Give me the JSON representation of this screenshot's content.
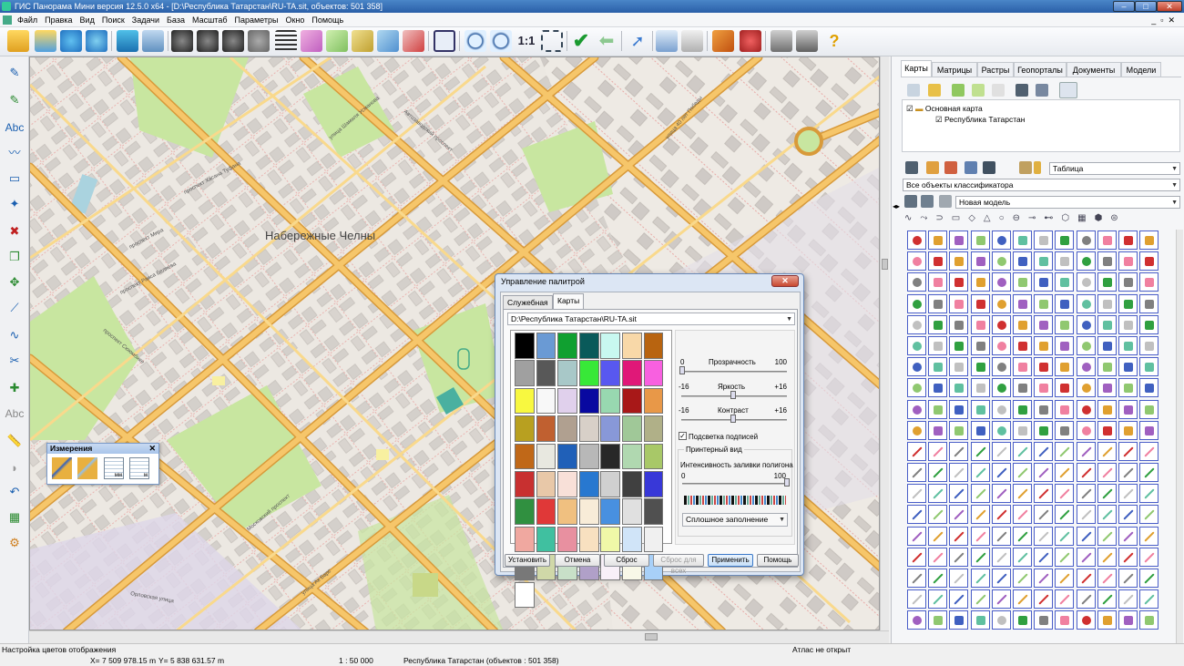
{
  "window": {
    "title": "ГИС Панорама Мини версия 12.5.0 x64 - [D:\\Республика Татарстан\\RU-TA.sit, объектов: 501 358]"
  },
  "menu": [
    "Файл",
    "Правка",
    "Вид",
    "Поиск",
    "Задачи",
    "База",
    "Масштаб",
    "Параметры",
    "Окно",
    "Помощь"
  ],
  "map": {
    "city_label": "Набережные Челны",
    "street_labels": [
      "проспект Хасана Туфана",
      "проспект Мира",
      "улица Шамиля Усманова",
      "проспект Сююмбике",
      "Московский проспект",
      "проспект Раиса Беляева",
      "улица 40 лет Победы",
      "Орловская улица",
      "Автозаводский проспект",
      "улица Ак Барс"
    ]
  },
  "measure_panel": {
    "title": "Измерения",
    "units": [
      "мм",
      "м"
    ]
  },
  "dialog": {
    "title": "Управление палитрой",
    "tabs": [
      "Служебная",
      "Карты"
    ],
    "file_path": "D:\\Республика Татарстан\\RU-TA.sit",
    "palette_colors": [
      "#000000",
      "#6a9ad4",
      "#10a030",
      "#0a5a5a",
      "#c8f8f0",
      "#f8d8a8",
      "#b86410",
      "#a0a0a0",
      "#585858",
      "#a8c8c8",
      "#38e838",
      "#5858f0",
      "#e01878",
      "#f860e0",
      "#f8f840",
      "#f8f8f8",
      "#e0d0ec",
      "#0808a0",
      "#98d8b0",
      "#a81818",
      "#e89848",
      "#b8a020",
      "#c06030",
      "#b0a090",
      "#d8d0c8",
      "#8898d8",
      "#a0c898",
      "#b0b088",
      "#c06818",
      "#e8e8e0",
      "#2060b8",
      "#b8b8b8",
      "#282828",
      "#b0d8b0",
      "#a8c868",
      "#c83030",
      "#e8c8a8",
      "#f8e0d8",
      "#2878d0",
      "#d0d0d0",
      "#404040",
      "#3838d8",
      "#309040",
      "#e03838",
      "#f0c080",
      "#f8ecd8",
      "#4890e0",
      "#e0e0e0",
      "#505050",
      "#f0a8a0",
      "#40c0a0",
      "#e890a0",
      "#f8e0c0",
      "#f0f8a8",
      "#d0e4f8",
      "#f0f0f0",
      "#787878",
      "#d0d8a8",
      "#c8e0c8",
      "#b0a0c8",
      "#f8f0f8",
      "#f8f8e8",
      "#a8d0f8",
      "#ffffff"
    ],
    "transparency": {
      "label": "Прозрачность",
      "min": "0",
      "max": "100",
      "value": 0
    },
    "brightness": {
      "label": "Яркость",
      "min": "-16",
      "max": "+16",
      "value": 0.5
    },
    "contrast": {
      "label": "Контраст",
      "min": "-16",
      "max": "+16",
      "value": 0.5
    },
    "highlight_labels": {
      "label": "Подсветка подписей",
      "checked": true
    },
    "printer_group": "Принтерный вид",
    "fill_intensity": {
      "label": "Интенсивность заливки полигона",
      "min": "0",
      "max": "100",
      "value": 1.0
    },
    "fill_mode": "Сплошное заполнение",
    "buttons": {
      "set": "Установить",
      "cancel": "Отмена",
      "reset": "Сброс",
      "reset_all": "Сброс для всех",
      "apply": "Применить",
      "help": "Помощь"
    }
  },
  "right_panel": {
    "tabs": [
      "Карты",
      "Матрицы",
      "Растры",
      "Геопорталы",
      "Документы",
      "Модели"
    ],
    "active_tab": "Карты",
    "tree": {
      "root": "Основная карта",
      "child": "Республика Татарстан"
    },
    "view_select": "Таблица",
    "classifier_select": "Все объекты классификатора",
    "model_select": "Новая модель"
  },
  "status": {
    "message": "Настройка цветов отображения",
    "atlas": "Атлас не открыт",
    "x": "X= 7 509 978.15 m",
    "y": "Y= 5 838 631.57 m",
    "scale": "1 : 50 000",
    "map_info": "Республика Татарстан  (объектов : 501 358)"
  },
  "colors": {
    "road": "#f6c66a",
    "road_edge": "#d89a3a",
    "park": "#c8e6a0",
    "building": "#cfcac6",
    "title_bar": "#2a5fa8",
    "map_bg": "#f2efe9"
  }
}
